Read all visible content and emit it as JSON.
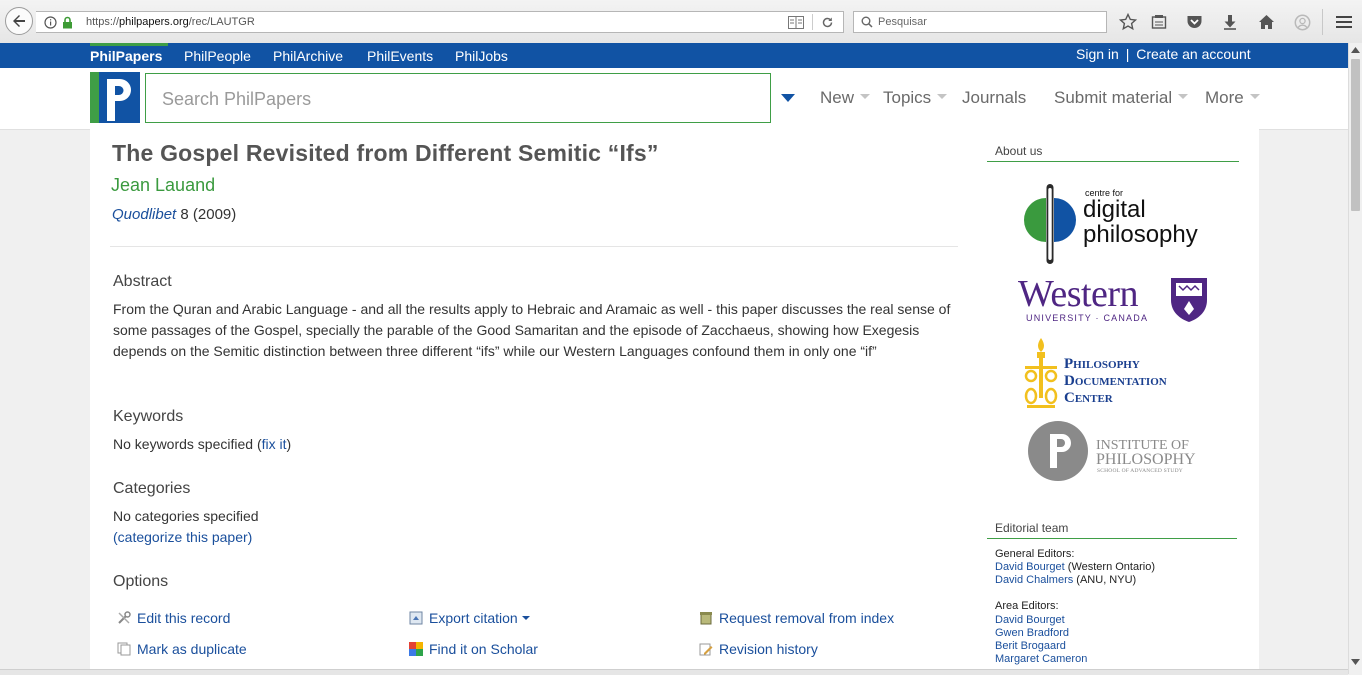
{
  "browser": {
    "url_prefix": "https://",
    "url_domain": "philpapers.org",
    "url_path": "/rec/LAUTGR",
    "search_placeholder": "Pesquisar"
  },
  "sites": {
    "items": [
      "PhilPapers",
      "PhilPeople",
      "PhilArchive",
      "PhilEvents",
      "PhilJobs"
    ],
    "sign_in": "Sign in",
    "separator": "|",
    "create_account": "Create an account"
  },
  "header": {
    "search_placeholder": "Search PhilPapers",
    "nav": [
      "New",
      "Topics",
      "Journals",
      "Submit material",
      "More"
    ]
  },
  "record": {
    "title": "The Gospel Revisited from Different Semitic “Ifs”",
    "author": "Jean Lauand",
    "journal": "Quodlibet",
    "issue": " 8 (2009)",
    "abstract_heading": "Abstract",
    "abstract": "From the Quran and Arabic Language - and all the results apply to Hebraic and Aramaic as well - this paper discusses the real sense of some passages of the Gospel, specially the parable of the Good Samaritan and the episode of Zacchaeus, showing how Exegesis depends on the Semitic distinction between three different “ifs” while our Western Languages confound them in only one “if”",
    "keywords_heading": "Keywords",
    "keywords_text": "No keywords specified (",
    "keywords_fix": "fix it",
    "keywords_close": ")",
    "categories_heading": "Categories",
    "categories_text": "No categories specified",
    "categories_open": "(",
    "categories_link": "categorize this paper",
    "categories_close": ")",
    "options_heading": "Options",
    "options": {
      "edit": "Edit this record",
      "export": "Export citation",
      "removal": "Request removal from index",
      "duplicate": "Mark as duplicate",
      "scholar": "Find it on Scholar",
      "history": "Revision history"
    }
  },
  "sidebar": {
    "about_heading": "About us",
    "logos": {
      "cdp_small": "centre for",
      "cdp_line1": "digital",
      "cdp_line2": "philosophy",
      "western": "Western",
      "western_sub": "UNIVERSITY · CANADA",
      "pdc_line1": "Philosophy",
      "pdc_line2": "Documentation",
      "pdc_line3": "Center",
      "iop_line1": "INSTITUTE OF",
      "iop_line2": "PHILOSOPHY",
      "iop_line3": "SCHOOL OF ADVANCED STUDY"
    },
    "editorial_heading": "Editorial team",
    "general_editors_label": "General Editors:",
    "general_editors": [
      {
        "name": "David Bourget",
        "affil": " (Western Ontario)"
      },
      {
        "name": "David Chalmers",
        "affil": " (ANU, NYU)"
      }
    ],
    "area_editors_label": "Area Editors:",
    "area_editors": [
      "David Bourget",
      "Gwen Bradford",
      "Berit Brogaard",
      "Margaret Cameron"
    ]
  },
  "colors": {
    "brand_blue": "#1153a4",
    "brand_green": "#3f9e46",
    "link": "#1a4f9c"
  }
}
